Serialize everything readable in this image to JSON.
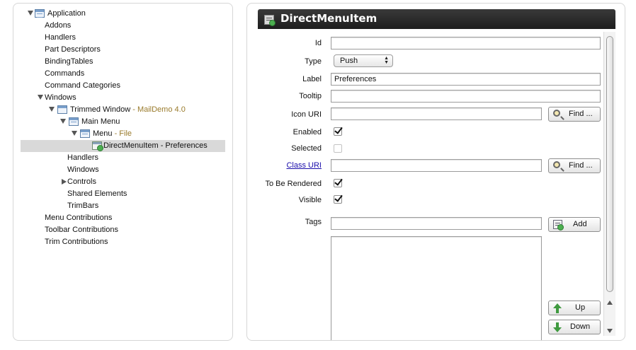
{
  "tree": {
    "items": [
      {
        "label": "Application",
        "suffix": ""
      },
      {
        "label": "Addons",
        "suffix": ""
      },
      {
        "label": "Handlers",
        "suffix": ""
      },
      {
        "label": "Part Descriptors",
        "suffix": ""
      },
      {
        "label": "BindingTables",
        "suffix": ""
      },
      {
        "label": "Commands",
        "suffix": ""
      },
      {
        "label": "Command Categories",
        "suffix": ""
      },
      {
        "label": "Windows",
        "suffix": ""
      },
      {
        "label": "Trimmed Window",
        "suffix": " - MailDemo 4.0"
      },
      {
        "label": "Main Menu",
        "suffix": ""
      },
      {
        "label": "Menu",
        "suffix": " - File"
      },
      {
        "label": "DirectMenuItem - Preferences",
        "suffix": ""
      },
      {
        "label": "Handlers",
        "suffix": ""
      },
      {
        "label": "Windows",
        "suffix": ""
      },
      {
        "label": "Controls",
        "suffix": ""
      },
      {
        "label": "Shared Elements",
        "suffix": ""
      },
      {
        "label": "TrimBars",
        "suffix": ""
      },
      {
        "label": "Menu Contributions",
        "suffix": ""
      },
      {
        "label": "Toolbar Contributions",
        "suffix": ""
      },
      {
        "label": "Trim Contributions",
        "suffix": ""
      }
    ]
  },
  "editor": {
    "title": "DirectMenuItem",
    "fields": {
      "id": {
        "label": "Id",
        "value": ""
      },
      "type": {
        "label": "Type",
        "value": "Push"
      },
      "label": {
        "label": "Label",
        "value": "Preferences"
      },
      "tooltip": {
        "label": "Tooltip",
        "value": ""
      },
      "icon_uri": {
        "label": "Icon URI",
        "value": ""
      },
      "enabled": {
        "label": "Enabled",
        "checked": true
      },
      "selected": {
        "label": "Selected",
        "checked": false
      },
      "class_uri": {
        "label": "Class URI",
        "value": ""
      },
      "to_be_rendered": {
        "label": "To Be Rendered",
        "checked": true
      },
      "visible": {
        "label": "Visible",
        "checked": true
      },
      "tags": {
        "label": "Tags",
        "value": ""
      }
    },
    "buttons": {
      "find": "Find ...",
      "add": "Add",
      "up": "Up",
      "down": "Down"
    }
  }
}
